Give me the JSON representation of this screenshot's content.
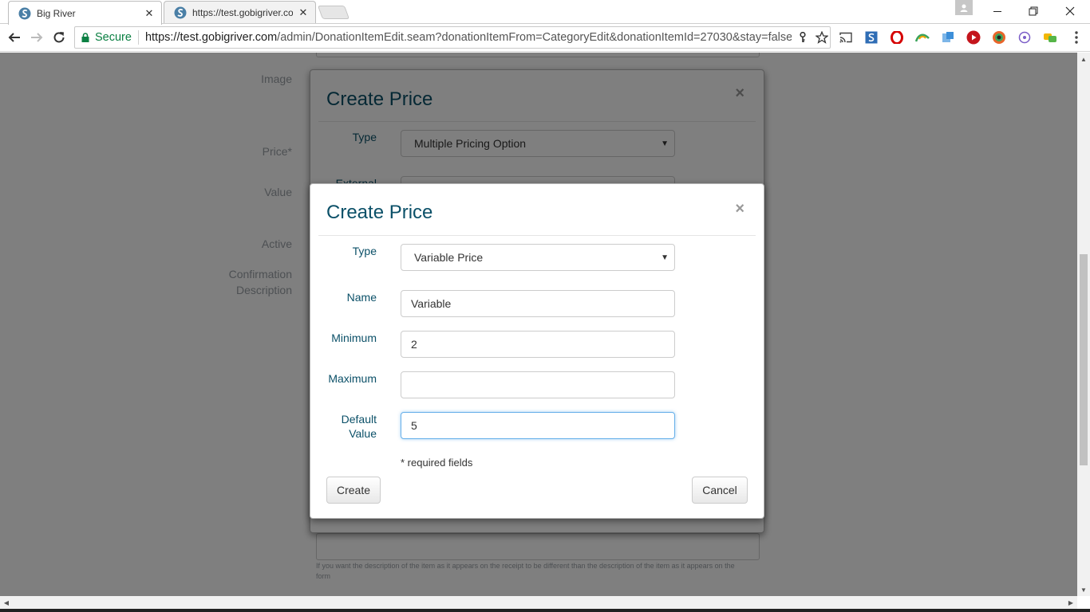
{
  "browser": {
    "tabs": [
      {
        "title": "Big River",
        "active": true
      },
      {
        "title": "https://test.gobigriver.co",
        "active": false
      }
    ],
    "secure_label": "Secure",
    "url_scheme_host": "https://test.gobigriver.com",
    "url_path": "/admin/DonationItemEdit.seam?donationItemFrom=CategoryEdit&donationItemId=27030&stay=false&",
    "extension_icons": [
      "cast-icon",
      "s-extension-icon",
      "opera-icon",
      "arc-icon",
      "puzzle-extension-icon",
      "youtube-icon",
      "color-picker-icon",
      "circle-extension-icon",
      "chat-extension-icon"
    ]
  },
  "background_form": {
    "labels": [
      "Image",
      "Price*",
      "Value",
      "Active",
      "Confirmation",
      "Description"
    ],
    "help_text": "If you want the description of the item as it appears on the receipt to be different than the description of the item as it appears on the form"
  },
  "back_modal": {
    "title": "Create Price",
    "close": "×",
    "type_label": "Type",
    "type_value": "Multiple Pricing Option",
    "external_label": "External"
  },
  "modal": {
    "title": "Create Price",
    "close": "×",
    "type_label": "Type",
    "type_value": "Variable Price",
    "name_label": "Name",
    "name_value": "Variable",
    "minimum_label": "Minimum",
    "minimum_value": "2",
    "maximum_label": "Maximum",
    "maximum_value": "",
    "default_label_line1": "Default",
    "default_label_line2": "Value",
    "default_value": "5",
    "required_note": "* required fields",
    "create_label": "Create",
    "cancel_label": "Cancel"
  },
  "colors": {
    "accent": "#0b5068",
    "secure_green": "#0b8043",
    "focus_border": "#66afe9"
  }
}
